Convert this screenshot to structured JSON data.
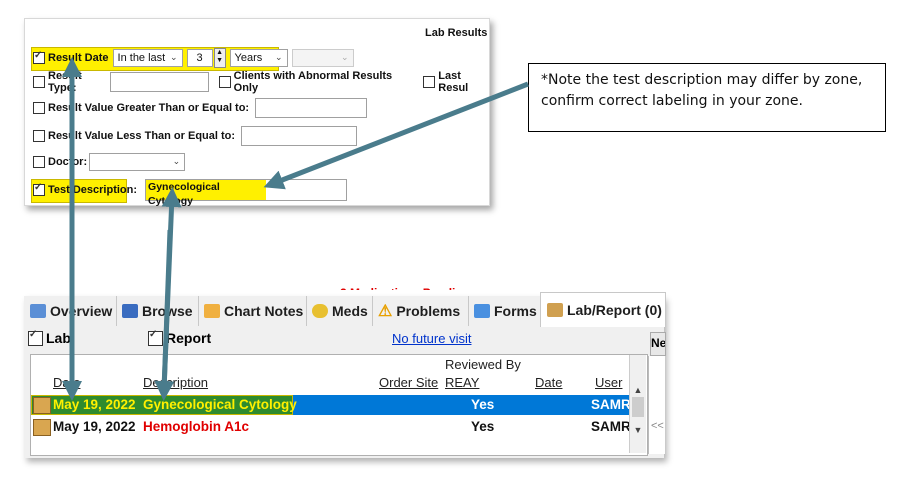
{
  "filter_panel": {
    "title": "Lab Results",
    "result_date": {
      "label": "Result Date",
      "range_select": "In the last",
      "number": "3",
      "unit_select": "Years",
      "checked": true
    },
    "result_type": {
      "label": "Result Type:",
      "checked": false
    },
    "abnormal_only": {
      "label": "Clients with Abnormal Results Only",
      "checked": false
    },
    "last_result": {
      "label": "Last Resul",
      "checked": false
    },
    "value_gte": {
      "label": "Result Value Greater Than or Equal to:",
      "checked": false
    },
    "value_lte": {
      "label": "Result Value Less Than or Equal to:",
      "checked": false
    },
    "doctor": {
      "label": "Doctor:",
      "checked": false
    },
    "test_description": {
      "label": "Test Description:",
      "value": "Gynecological Cytology",
      "checked": true
    }
  },
  "note": {
    "text": "*Note the test description may differ by zone, confirm correct labeling in your zone."
  },
  "lab_panel": {
    "banner_partial": "2 Medications Pending",
    "tabs": [
      {
        "label": "Overview",
        "icon": "overview-icon"
      },
      {
        "label": "Browse",
        "icon": "browse-icon"
      },
      {
        "label": "Chart Notes",
        "icon": "chart-notes-icon"
      },
      {
        "label": "Meds",
        "icon": "pill-icon"
      },
      {
        "label": "Problems",
        "icon": "warning-icon"
      },
      {
        "label": "Forms",
        "icon": "forms-icon"
      },
      {
        "label": "Lab/Report (0)",
        "icon": "lab-icon"
      }
    ],
    "side_button": "Ne",
    "lab_checkbox": "Lab",
    "report_checkbox": "Report",
    "future_visit_link": "No future visit",
    "columns": {
      "date": "Date",
      "description": "Description",
      "order_site": "Order Site",
      "reviewed_by": "Reviewed By",
      "reay": "REAY",
      "date2": "Date",
      "user": "User"
    },
    "rows": [
      {
        "date": "May 19, 2022",
        "description": "Gynecological Cytology",
        "reay": "Yes",
        "user": "SAMR",
        "selected": true
      },
      {
        "date": "May 19, 2022",
        "description": "Hemoglobin A1c",
        "reay": "Yes",
        "user": "SAMR",
        "selected": false
      }
    ],
    "pager_prev": "<<"
  },
  "colors": {
    "highlight": "#fff000",
    "arrow": "#4a7c8c",
    "selection": "#0078d7",
    "red_text": "#e00000"
  }
}
